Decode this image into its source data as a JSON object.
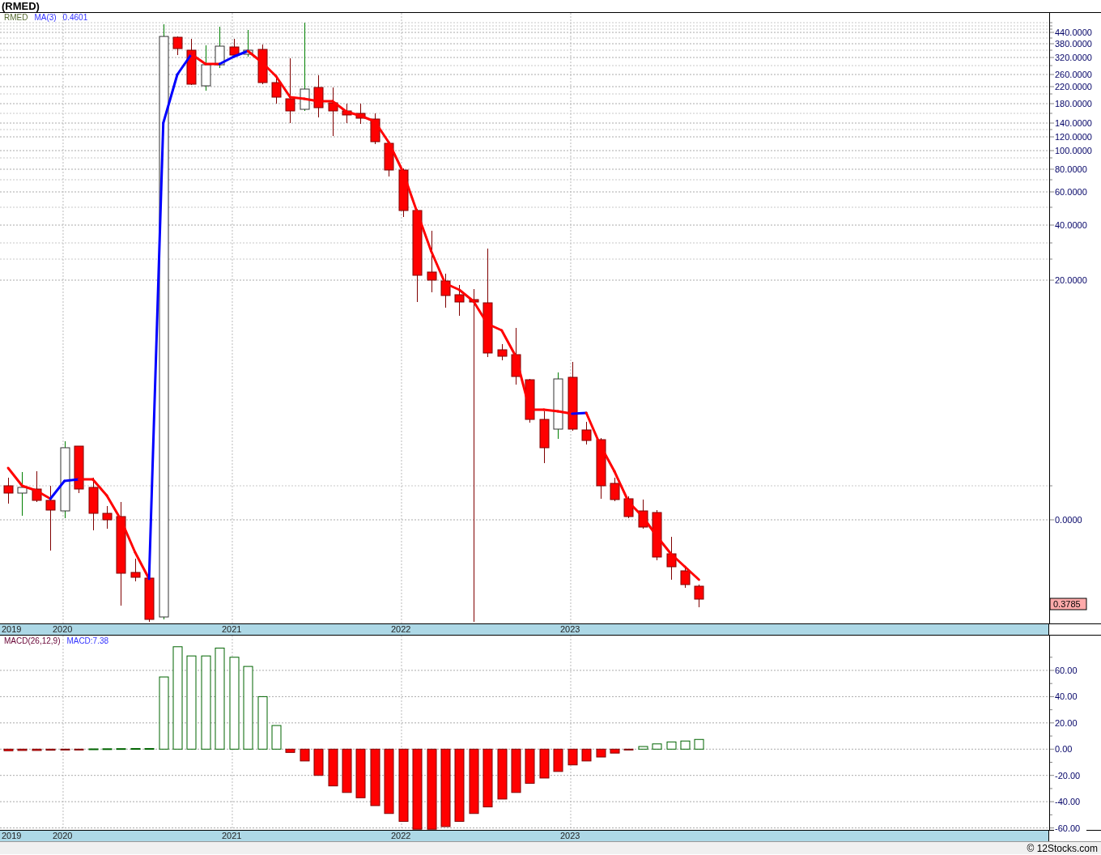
{
  "title": "(RMED)",
  "price_panel": {
    "legend": [
      {
        "kind": "symbol",
        "text": "RMED"
      },
      {
        "kind": "indicator",
        "text": "MA(3)"
      },
      {
        "kind": "value",
        "text": "0.4601"
      }
    ],
    "axis_labels": [
      "440.0000",
      "380.0000",
      "320.0000",
      "260.0000",
      "220.0000",
      "180.0000",
      "140.0000",
      "120.0000",
      "100.0000",
      "80.0000",
      "60.0000",
      "40.0000",
      "20.0000",
      "0.0000"
    ],
    "last_price": "0.3785",
    "date_labels": [
      "2019",
      "2020",
      "2021",
      "2022",
      "2023"
    ]
  },
  "macd_panel": {
    "legend": [
      {
        "kind": "symbol",
        "text": "MACD(26,12,9)"
      },
      {
        "kind": "value",
        "text": "MACD:7.38"
      }
    ],
    "edge_year_label": "2019",
    "chart_data": {
      "type": "bar",
      "grid": true,
      "ylim": [
        -61.5,
        86.5
      ],
      "xlim": [
        2019.627,
        2026.134
      ],
      "x": [
        2019.675,
        2019.758,
        2019.842,
        2019.925,
        2020.008,
        2020.092,
        2020.175,
        2020.258,
        2020.342,
        2020.425,
        2020.508,
        2020.592,
        2020.675,
        2020.758,
        2020.842,
        2020.925,
        2021.008,
        2021.092,
        2021.175,
        2021.258,
        2021.342,
        2021.425,
        2021.508,
        2021.592,
        2021.675,
        2021.758,
        2021.842,
        2021.925,
        2022.008,
        2022.092,
        2022.175,
        2022.258,
        2022.342,
        2022.425,
        2022.508,
        2022.592,
        2022.675,
        2022.758,
        2022.842,
        2022.925,
        2023.008,
        2023.092,
        2023.175,
        2023.258,
        2023.342,
        2023.425,
        2023.508,
        2023.592,
        2023.675,
        2023.758
      ],
      "values": [
        -1.2,
        -1,
        -1,
        -0.8,
        -0.5,
        -0.3,
        0.2,
        0.3,
        0.4,
        0.5,
        0.5,
        55,
        78,
        71,
        71,
        77,
        70,
        63,
        40,
        18,
        -2.5,
        -9,
        -20,
        -28,
        -33,
        -37,
        -43,
        -49,
        -55,
        -61,
        -61,
        -59,
        -55,
        -49,
        -44,
        -38,
        -33,
        -26,
        -22,
        -17,
        -12,
        -9,
        -6,
        -3,
        -0.6,
        2,
        4,
        5.5,
        6.2,
        7.4
      ],
      "yticks": [
        {
          "value": 60,
          "label": "60.00"
        },
        {
          "value": 40,
          "label": "40.00"
        },
        {
          "value": 20,
          "label": "20.00"
        },
        {
          "value": 0,
          "label": "0.00"
        },
        {
          "value": -20,
          "label": "-20.00"
        },
        {
          "value": -40,
          "label": "-40.00"
        },
        {
          "value": -60,
          "label": "-60.00"
        }
      ],
      "xticks": [
        {
          "value": 2020,
          "label": "2020"
        },
        {
          "value": 2021,
          "label": "2021"
        },
        {
          "value": 2022,
          "label": "2022"
        },
        {
          "value": 2023,
          "label": "2023"
        }
      ]
    }
  },
  "footer": "© 12Stocks.com"
}
